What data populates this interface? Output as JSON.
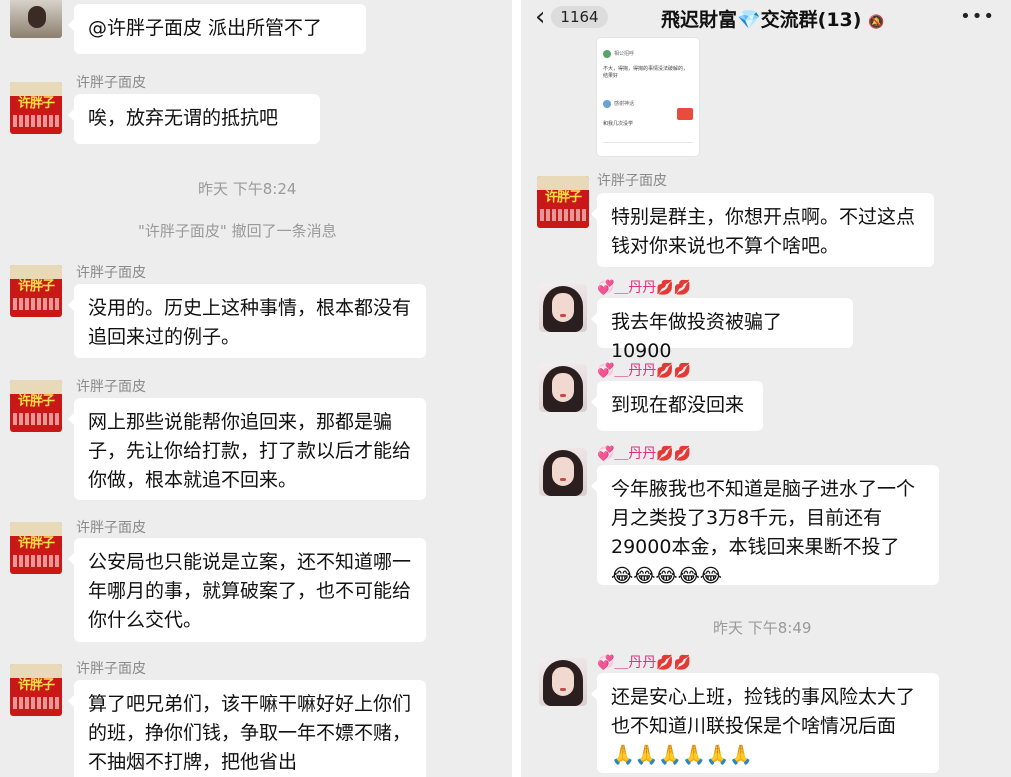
{
  "left": {
    "top_message": "@许胖子面皮 派出所管不了",
    "avatar_brand": "许胖子",
    "messages": [
      {
        "sender": "许胖子面皮",
        "text": "唉，放弃无谓的抵抗吧"
      },
      {
        "sender": "许胖子面皮",
        "text": "没用的。历史上这种事情，根本都没有追回来过的例子。"
      },
      {
        "sender": "许胖子面皮",
        "text": "网上那些说能帮你追回来，那都是骗子，先让你给打款，打了款以后才能给你做，根本就追不回来。"
      },
      {
        "sender": "许胖子面皮",
        "text": "公安局也只能说是立案，还不知道哪一年哪月的事，就算破案了，也不可能给你什么交代。"
      },
      {
        "sender": "许胖子面皮",
        "text": "算了吧兄弟们，该干嘛干嘛好好上你们的班，挣你们钱，争取一年不嫖不赌，不抽烟不打牌，把他省出"
      }
    ],
    "timestamp": "昨天 下午8:24",
    "recall_notice": "\"许胖子面皮\" 撤回了一条消息"
  },
  "right": {
    "header": {
      "back_count": "1164",
      "title": "飛迟財富💎交流群(13)",
      "mute_icon": "bell-off-icon",
      "more_label": "•••"
    },
    "screenshot_image": {
      "lines": [
        "相公招呼",
        "不大，得掬，得掬的事情没法破解的，结果好",
        "感谢神话",
        "和我几次没学"
      ]
    },
    "messages": [
      {
        "sender": "许胖子面皮",
        "text": "特别是群主，你想开点啊。不过这点钱对你来说也不算个啥吧。"
      },
      {
        "sender": "💞＿丹丹💋💋",
        "text": "我去年做投资被骗了10900"
      },
      {
        "sender": "💞＿丹丹💋💋",
        "text": "到现在都没回来"
      },
      {
        "sender": "💞＿丹丹💋💋",
        "text": "今年腋我也不知道是脑子进水了一个月之类投了3万8千元，目前还有29000本金，本钱回来果断不投了",
        "emojis": "😂😂😂😂😂"
      },
      {
        "sender": "💞＿丹丹💋💋",
        "text": "还是安心上班，捡钱的事风险太大了也不知道川联投保是个啥情况后面",
        "emojis": "🙏🙏🙏🙏🙏🙏"
      }
    ],
    "timestamp": "昨天 下午8:49"
  },
  "colors": {
    "bg": "#ededed",
    "bubble": "#ffffff",
    "meta_text": "#9a9a9a",
    "avatar_red": "#c81818"
  }
}
